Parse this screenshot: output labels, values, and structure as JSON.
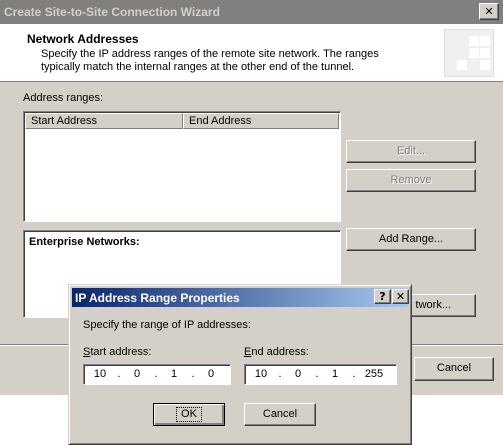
{
  "wizard": {
    "title": "Create Site-to-Site Connection Wizard",
    "close_glyph": "✕",
    "header": {
      "title": "Network Addresses",
      "subtitle": "Specify the IP address ranges of the remote site network. The ranges typically match the internal ranges at the other end of the tunnel."
    },
    "address_ranges_label": "Address ranges:",
    "columns": [
      "Start Address",
      "End Address"
    ],
    "buttons": {
      "edit": "Edit...",
      "remove": "Remove",
      "add_range": "Add Range...",
      "add_network_partial": "twork...",
      "cancel": "Cancel"
    },
    "enterprise_networks_label": "Enterprise Networks:"
  },
  "dialog": {
    "title": "IP Address Range Properties",
    "help_glyph": "?",
    "close_glyph": "✕",
    "instruction": "Specify the range of IP addresses:",
    "start_label": "Start address:",
    "end_label": "End address:",
    "start_address": {
      "o1": "10",
      "o2": "0",
      "o3": "1",
      "o4": "0"
    },
    "end_address": {
      "o1": "10",
      "o2": "0",
      "o3": "1",
      "o4": "255"
    },
    "dot": ".",
    "ok_label": "OK",
    "cancel_label": "Cancel"
  },
  "colors": {
    "dialog_face": "#d4d0c8",
    "active_title_start": "#0a246a",
    "active_title_end": "#a6caf0",
    "inactive_title": "#808080"
  }
}
